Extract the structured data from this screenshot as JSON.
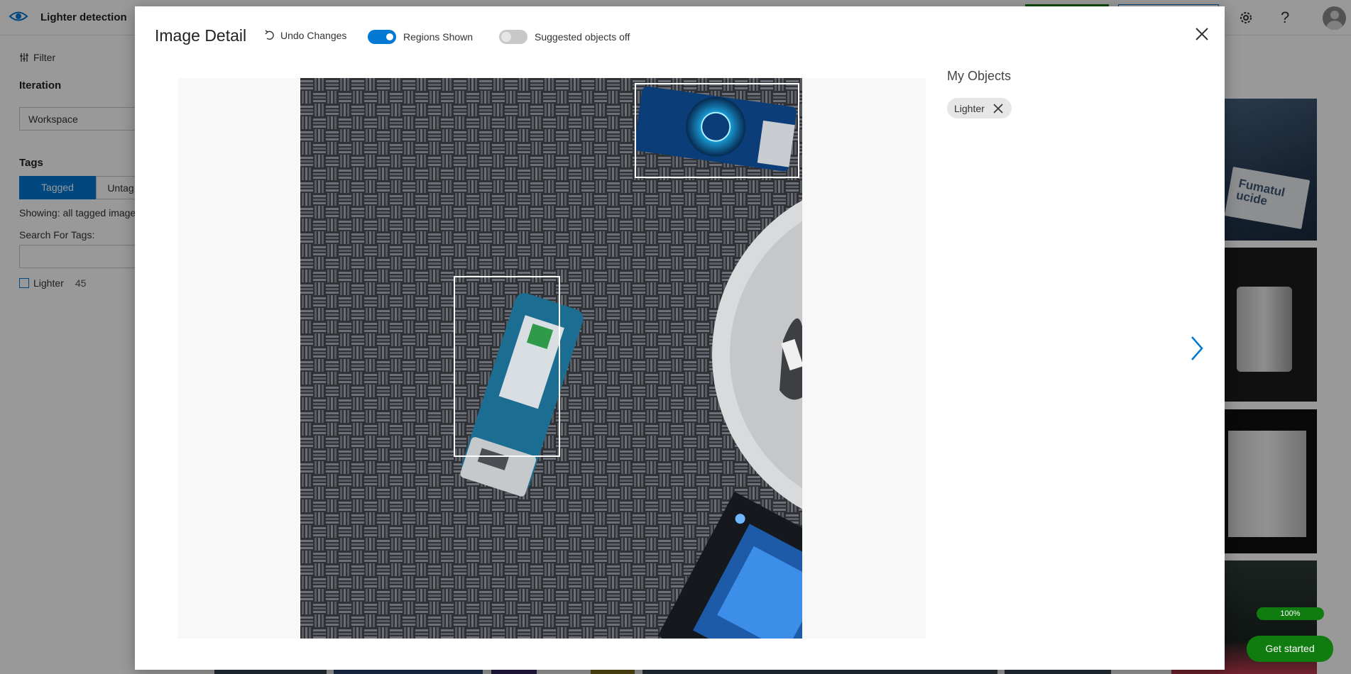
{
  "app": {
    "title": "Lighter detection",
    "help_glyph": "?",
    "icons": [
      "eye-icon",
      "gear-icon",
      "help-icon",
      "avatar"
    ]
  },
  "sidebar": {
    "filter_label": "Filter",
    "iteration_heading": "Iteration",
    "iteration_value": "Workspace",
    "tags_heading": "Tags",
    "tab_tagged": "Tagged",
    "tab_untagged": "Untag",
    "showing_text": "Showing: all tagged image",
    "search_label": "Search For Tags:",
    "tag_items": [
      {
        "label": "Lighter",
        "count": "45"
      }
    ]
  },
  "modal": {
    "title": "Image Detail",
    "undo_label": "Undo Changes",
    "regions_toggle": {
      "label": "Regions Shown",
      "state": "on"
    },
    "suggested_toggle": {
      "label": "Suggested objects off",
      "state": "off"
    },
    "my_objects_title": "My Objects",
    "objects": [
      {
        "label": "Lighter"
      }
    ]
  },
  "progress": {
    "label": "100%",
    "value": 1.0
  },
  "cta": {
    "label": "Get started"
  },
  "thumbnail_text": "Fumatul ucide",
  "colors": {
    "accent": "#0078d4",
    "success": "#107c10"
  }
}
